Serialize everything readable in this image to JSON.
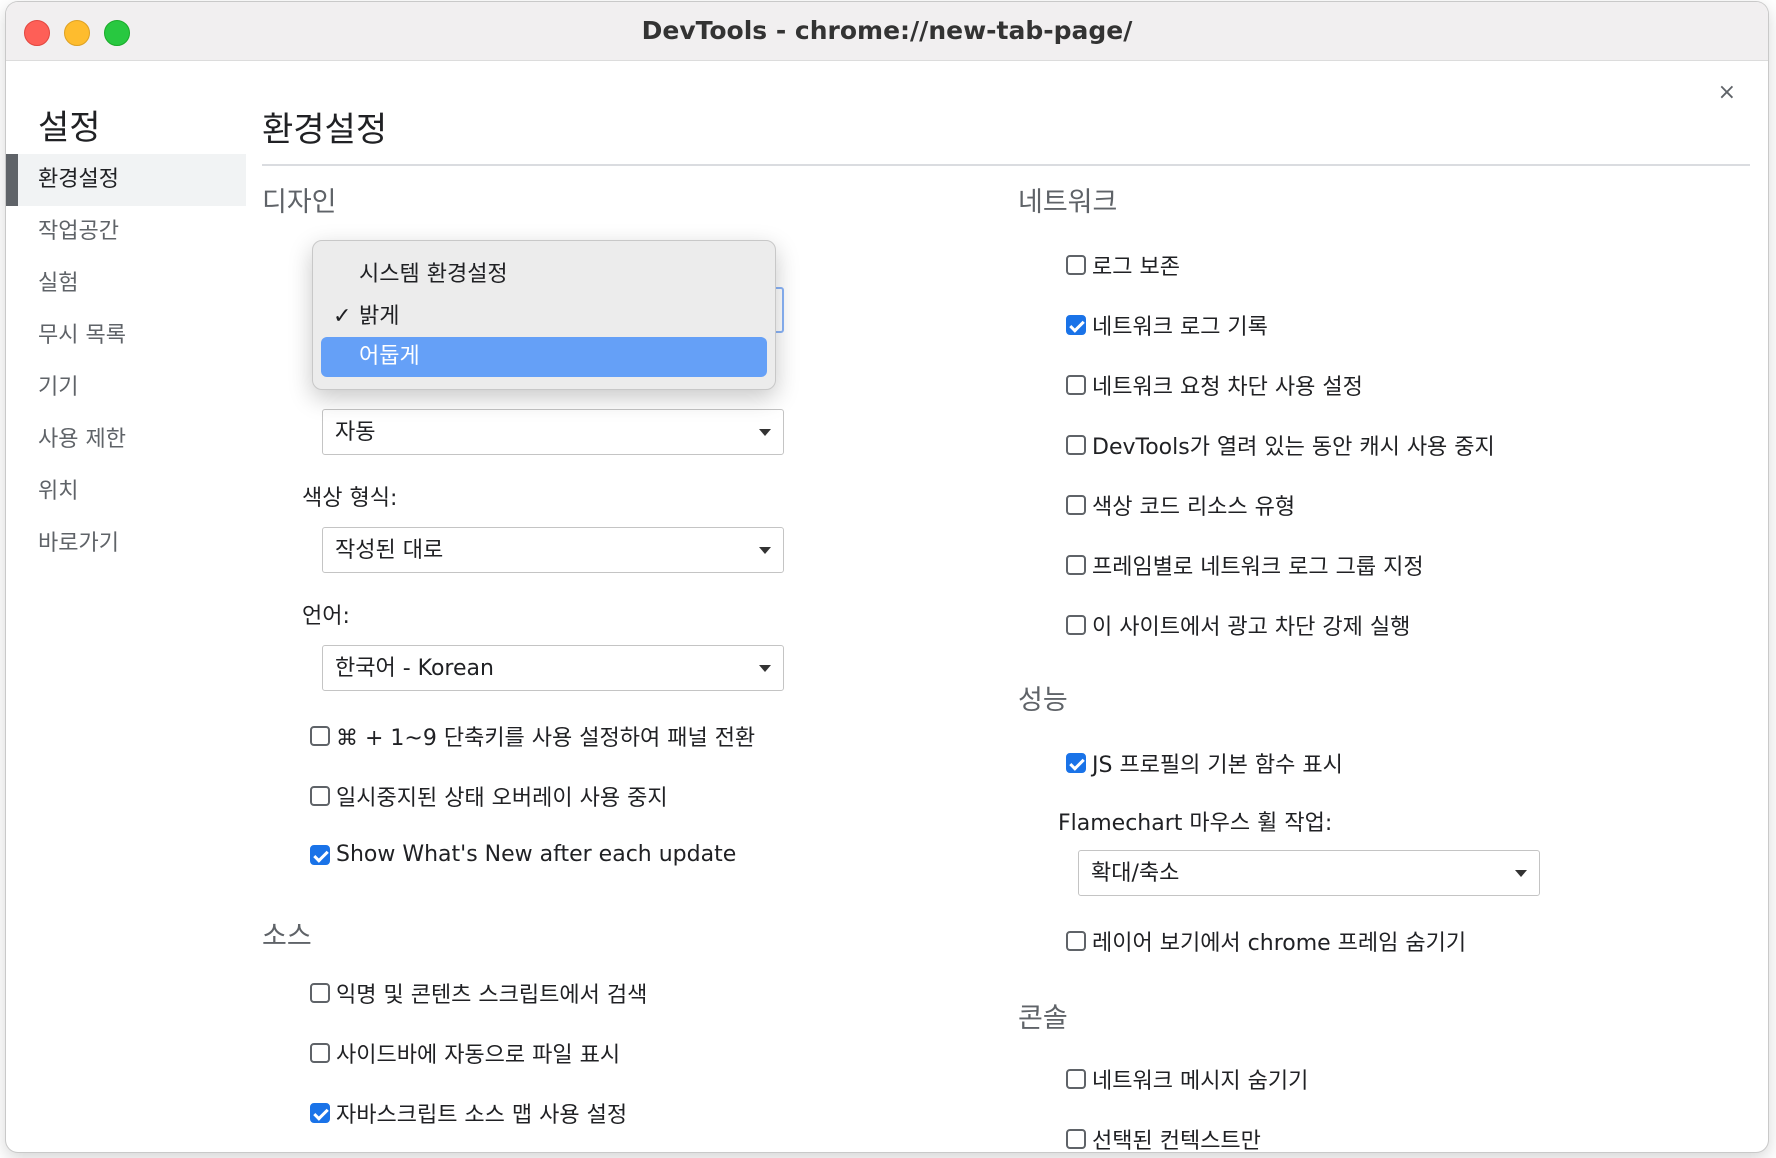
{
  "window": {
    "title": "DevTools - chrome://new-tab-page/",
    "close": "×"
  },
  "sidebar": {
    "title": "설정",
    "items": [
      {
        "label": "환경설정",
        "selected": true
      },
      {
        "label": "작업공간"
      },
      {
        "label": "실험"
      },
      {
        "label": "무시 목록"
      },
      {
        "label": "기기"
      },
      {
        "label": "사용 제한"
      },
      {
        "label": "위치"
      },
      {
        "label": "바로가기"
      }
    ]
  },
  "main": {
    "title": "환경설정",
    "design": {
      "heading": "디자인",
      "theme_popup": {
        "options": [
          "시스템 환경설정",
          "밝게",
          "어둡게"
        ],
        "checked": "밝게",
        "highlighted": "어둡게"
      },
      "panel_layout_select": "자동",
      "color_format_label": "색상 형식:",
      "color_format_select": "작성된 대로",
      "language_label": "언어:",
      "language_select": "한국어 - Korean",
      "checks": [
        {
          "label": "⌘ + 1~9 단축키를 사용 설정하여 패널 전환",
          "checked": false
        },
        {
          "label": "일시중지된 상태 오버레이 사용 중지",
          "checked": false
        },
        {
          "label": "Show What's New after each update",
          "checked": true
        }
      ]
    },
    "sources": {
      "heading": "소스",
      "checks": [
        {
          "label": "익명 및 콘텐츠 스크립트에서 검색",
          "checked": false
        },
        {
          "label": "사이드바에 자동으로 파일 표시",
          "checked": false
        },
        {
          "label": "자바스크립트 소스 맵 사용 설정",
          "checked": true
        }
      ]
    },
    "network": {
      "heading": "네트워크",
      "checks": [
        {
          "label": "로그 보존",
          "checked": false
        },
        {
          "label": "네트워크 로그 기록",
          "checked": true
        },
        {
          "label": "네트워크 요청 차단 사용 설정",
          "checked": false
        },
        {
          "label": "DevTools가 열려 있는 동안 캐시 사용 중지",
          "checked": false
        },
        {
          "label": "색상 코드 리소스 유형",
          "checked": false
        },
        {
          "label": "프레임별로 네트워크 로그 그룹 지정",
          "checked": false
        },
        {
          "label": "이 사이트에서 광고 차단 강제 실행",
          "checked": false
        }
      ]
    },
    "performance": {
      "heading": "성능",
      "check_native": {
        "label": "JS 프로필의 기본 함수 표시",
        "checked": true
      },
      "flamechart_label": "Flamechart 마우스 휠 작업:",
      "flamechart_select": "확대/축소",
      "check_layers": {
        "label": "레이어 보기에서 chrome 프레임 숨기기",
        "checked": false
      }
    },
    "console": {
      "heading": "콘솔",
      "checks": [
        {
          "label": "네트워크 메시지 숨기기",
          "checked": false
        },
        {
          "label": "선택된 컨텍스트만",
          "checked": false
        }
      ]
    }
  }
}
